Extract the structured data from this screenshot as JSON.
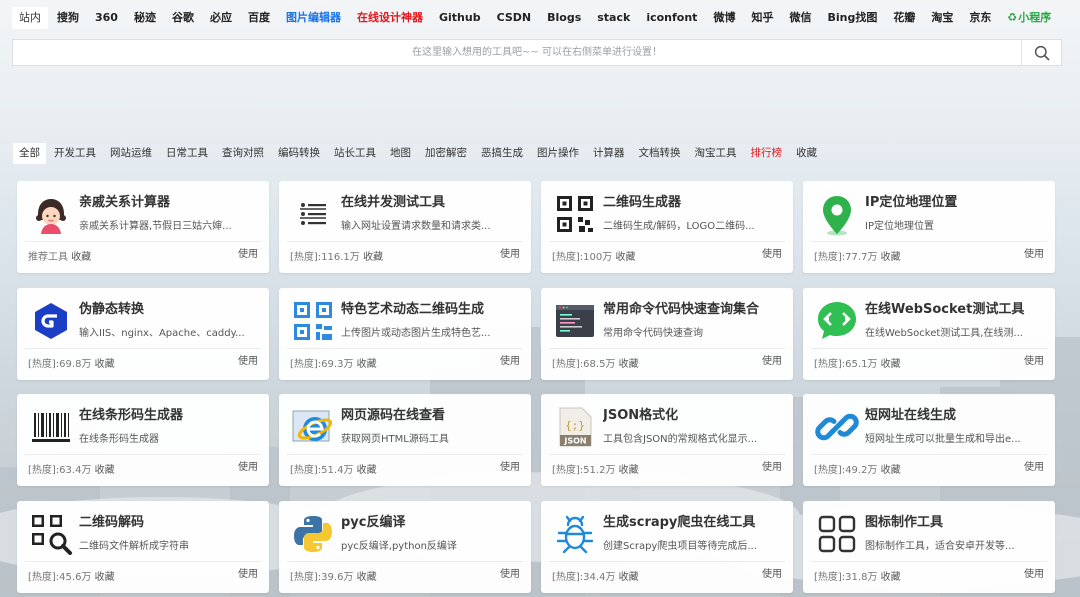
{
  "engines": [
    {
      "label": "站内",
      "style": "active"
    },
    {
      "label": "搜狗",
      "style": ""
    },
    {
      "label": "360",
      "style": ""
    },
    {
      "label": "秘迹",
      "style": ""
    },
    {
      "label": "谷歌",
      "style": ""
    },
    {
      "label": "必应",
      "style": ""
    },
    {
      "label": "百度",
      "style": ""
    },
    {
      "label": "图片编辑器",
      "style": "blue"
    },
    {
      "label": "在线设计神器",
      "style": "red"
    },
    {
      "label": "Github",
      "style": ""
    },
    {
      "label": "CSDN",
      "style": ""
    },
    {
      "label": "Blogs",
      "style": ""
    },
    {
      "label": "stack",
      "style": ""
    },
    {
      "label": "iconfont",
      "style": ""
    },
    {
      "label": "微博",
      "style": ""
    },
    {
      "label": "知乎",
      "style": ""
    },
    {
      "label": "微信",
      "style": ""
    },
    {
      "label": "Bing找图",
      "style": ""
    },
    {
      "label": "花瓣",
      "style": ""
    },
    {
      "label": "淘宝",
      "style": ""
    },
    {
      "label": "京东",
      "style": ""
    },
    {
      "label": "小程序",
      "style": "green"
    }
  ],
  "search": {
    "placeholder": "在这里输入想用的工具吧~~ 可以在右侧菜单进行设置！"
  },
  "categories": [
    {
      "label": "全部",
      "style": "active"
    },
    {
      "label": "开发工具",
      "style": ""
    },
    {
      "label": "网站运维",
      "style": ""
    },
    {
      "label": "日常工具",
      "style": ""
    },
    {
      "label": "查询对照",
      "style": ""
    },
    {
      "label": "编码转换",
      "style": ""
    },
    {
      "label": "站长工具",
      "style": ""
    },
    {
      "label": "地图",
      "style": ""
    },
    {
      "label": "加密解密",
      "style": ""
    },
    {
      "label": "恶搞生成",
      "style": ""
    },
    {
      "label": "图片操作",
      "style": ""
    },
    {
      "label": "计算器",
      "style": ""
    },
    {
      "label": "文档转换",
      "style": ""
    },
    {
      "label": "淘宝工具",
      "style": ""
    },
    {
      "label": "排行榜",
      "style": "red"
    },
    {
      "label": "收藏",
      "style": ""
    }
  ],
  "use_label": "使用",
  "fav_label": "收藏",
  "tools": [
    {
      "title": "亲戚关系计算器",
      "desc": "亲戚关系计算器,节假日三姑六婶...",
      "meta": "推荐工具",
      "icon": "girl-avatar-icon"
    },
    {
      "title": "在线并发测试工具",
      "desc": "输入网址设置请求数量和请求类...",
      "meta": "[热度]:116.1万",
      "icon": "list-lines-icon"
    },
    {
      "title": "二维码生成器",
      "desc": "二维码生成/解码，LOGO二维码...",
      "meta": "[热度]:100万",
      "icon": "qrcode-icon"
    },
    {
      "title": "IP定位地理位置",
      "desc": "IP定位地理位置",
      "meta": "[热度]:77.7万",
      "icon": "map-pin-icon"
    },
    {
      "title": "伪静态转换",
      "desc": "输入IIS、nginx、Apache、caddy...",
      "meta": "[热度]:69.8万",
      "icon": "g-hexagon-icon"
    },
    {
      "title": "特色艺术动态二维码生成",
      "desc": "上传图片或动态图片生成特色艺...",
      "meta": "[热度]:69.3万",
      "icon": "blue-qrcode-icon"
    },
    {
      "title": "常用命令代码快速查询集合",
      "desc": "常用命令代码快速查询",
      "meta": "[热度]:68.5万",
      "icon": "terminal-icon"
    },
    {
      "title": "在线WebSocket测试工具",
      "desc": "在线WebSocket测试工具,在线测...",
      "meta": "[热度]:65.1万",
      "icon": "websocket-icon"
    },
    {
      "title": "在线条形码生成器",
      "desc": "在线条形码生成器",
      "meta": "[热度]:63.4万",
      "icon": "barcode-icon"
    },
    {
      "title": "网页源码在线查看",
      "desc": "获取网页HTML源码工具",
      "meta": "[热度]:51.4万",
      "icon": "ie-browser-icon"
    },
    {
      "title": "JSON格式化",
      "desc": "工具包含JSON的常规格式化显示...",
      "meta": "[热度]:51.2万",
      "icon": "json-file-icon"
    },
    {
      "title": "短网址在线生成",
      "desc": "短网址生成可以批量生成和导出e...",
      "meta": "[热度]:49.2万",
      "icon": "link-icon"
    },
    {
      "title": "二维码解码",
      "desc": "二维码文件解析成字符串",
      "meta": "[热度]:45.6万",
      "icon": "qrcode-search-icon"
    },
    {
      "title": "pyc反编译",
      "desc": "pyc反编译,python反编译",
      "meta": "[热度]:39.6万",
      "icon": "python-icon"
    },
    {
      "title": "生成scrapy爬虫在线工具",
      "desc": "创建Scrapy爬虫项目等待完成后...",
      "meta": "[热度]:34.4万",
      "icon": "bug-icon"
    },
    {
      "title": "图标制作工具",
      "desc": "图标制作工具，适合安卓开发等...",
      "meta": "[热度]:31.8万",
      "icon": "icon-grid-icon"
    }
  ]
}
